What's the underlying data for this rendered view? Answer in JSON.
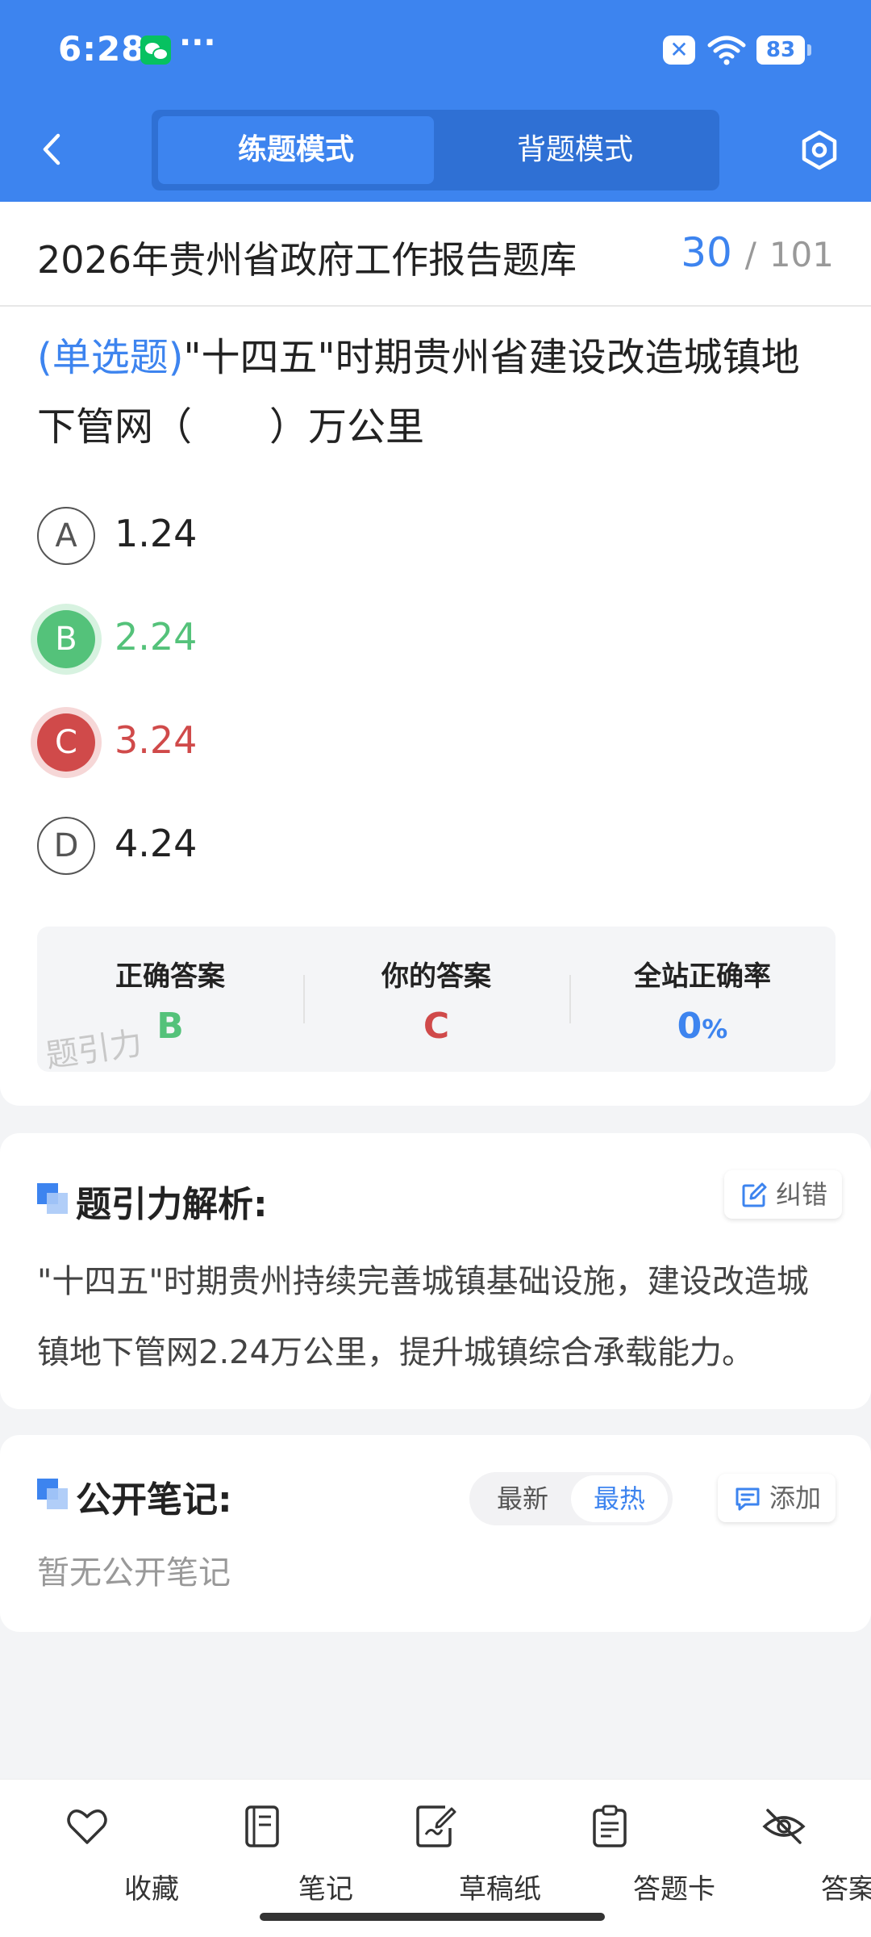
{
  "status_bar": {
    "time": "6:28",
    "dots": "···",
    "notif_icon": "✕",
    "battery": "83"
  },
  "header": {
    "modes": [
      "练题模式",
      "背题模式"
    ],
    "active_mode": "练题模式",
    "accent": "#3d84ef"
  },
  "bank": {
    "title": "2026年贵州省政府工作报告题库",
    "current": "30",
    "separator": "/",
    "total": "101"
  },
  "question": {
    "type": "(单选题)",
    "text": "\"十四五\"时期贵州省建设改造城镇地下管网（　　）万公里",
    "options": [
      {
        "letter": "A",
        "value": "1.24",
        "state": "normal"
      },
      {
        "letter": "B",
        "value": "2.24",
        "state": "correct"
      },
      {
        "letter": "C",
        "value": "3.24",
        "state": "wrong"
      },
      {
        "letter": "D",
        "value": "4.24",
        "state": "normal"
      }
    ]
  },
  "result": {
    "correct_label": "正确答案",
    "correct_value": "B",
    "yours_label": "你的答案",
    "yours_value": "C",
    "rate_label": "全站正确率",
    "rate_value": "0",
    "rate_unit": "%",
    "watermark": "题引力",
    "colors": {
      "correct": "#54c27a",
      "wrong": "#d04a4a"
    }
  },
  "analysis": {
    "title": "题引力解析:",
    "correct_btn": "纠错",
    "text": "\"十四五\"时期贵州持续完善城镇基础设施，建设改造城镇地下管网2.24万公里，提升城镇综合承载能力。"
  },
  "notes": {
    "title": "公开笔记:",
    "sort_options": [
      "最新",
      "最热"
    ],
    "active_sort": "最热",
    "add_btn": "添加",
    "empty": "暂无公开笔记"
  },
  "bottom_tabs": [
    {
      "label": "收藏",
      "icon": "heart-icon"
    },
    {
      "label": "笔记",
      "icon": "notebook-icon"
    },
    {
      "label": "草稿纸",
      "icon": "draft-icon"
    },
    {
      "label": "答题卡",
      "icon": "answer-sheet-icon"
    },
    {
      "label": "答案",
      "icon": "eye-off-icon"
    }
  ]
}
